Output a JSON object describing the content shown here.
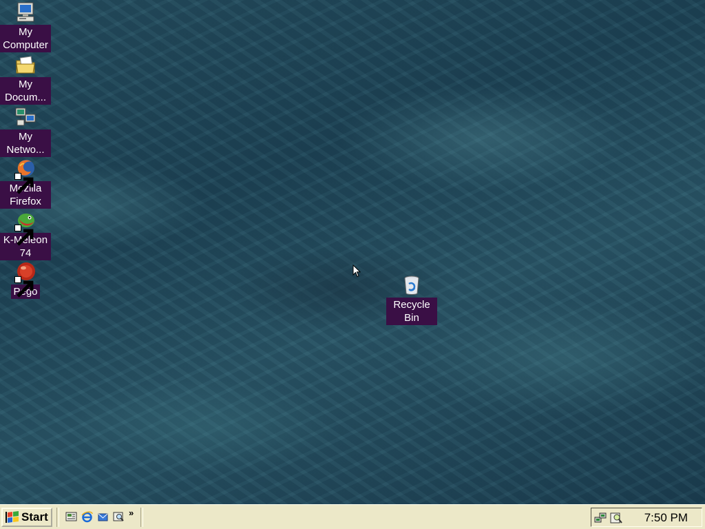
{
  "desktop": {
    "icons": [
      {
        "label": "My Computer",
        "icon": "my-computer-icon"
      },
      {
        "label": "My Docum...",
        "icon": "my-documents-icon"
      },
      {
        "label": "My Netwo...",
        "icon": "my-network-icon"
      },
      {
        "label": "Mozilla Firefox",
        "icon": "firefox-icon"
      },
      {
        "label": "K-Meleon 74",
        "icon": "k-meleon-icon"
      },
      {
        "label": "Pego",
        "icon": "pego-icon"
      },
      {
        "label": "Recycle Bin",
        "icon": "recycle-bin-icon"
      }
    ],
    "label_bg_color": "#3a0f45"
  },
  "taskbar": {
    "start_label": "Start",
    "quick_launch": [
      {
        "icon": "show-desktop-icon"
      },
      {
        "icon": "internet-explorer-icon"
      },
      {
        "icon": "outlook-express-icon"
      },
      {
        "icon": "search-icon"
      }
    ],
    "more_label": "»",
    "tray": {
      "icons": [
        "network-connection-icon",
        "search-tray-icon"
      ],
      "clock": "7:50 PM"
    },
    "color": "#ece8c8"
  }
}
